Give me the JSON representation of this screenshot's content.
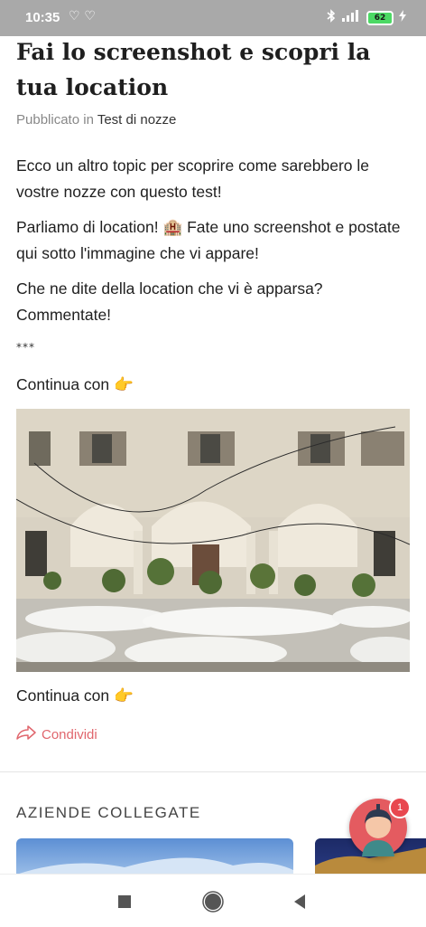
{
  "status_bar": {
    "time": "10:35",
    "hearts": "♡ ♡",
    "battery": "62"
  },
  "article": {
    "title": "Fai lo screenshot e scopri la tua location",
    "published_label": "Pubblicato",
    "in_label": "in",
    "category": "Test di nozze",
    "paragraphs": [
      "Ecco un altro topic per scoprire come sarebbero le vostre nozze con questo test!",
      "Parliamo di location! 🏨 Fate uno screenshot e postate qui sotto l'immagine che vi appare!",
      "Che ne dite della location che vi è apparsa? Commentate!"
    ],
    "separator": "***",
    "continue_text": "Continua con 👉",
    "continue_text_2": "Continua con 👉",
    "share_label": "Condividi"
  },
  "related": {
    "title": "AZIENDE COLLEGATE"
  },
  "fab": {
    "badge": "1"
  },
  "colors": {
    "accent": "#e0666d",
    "status_bar": "#a9a9a9"
  }
}
